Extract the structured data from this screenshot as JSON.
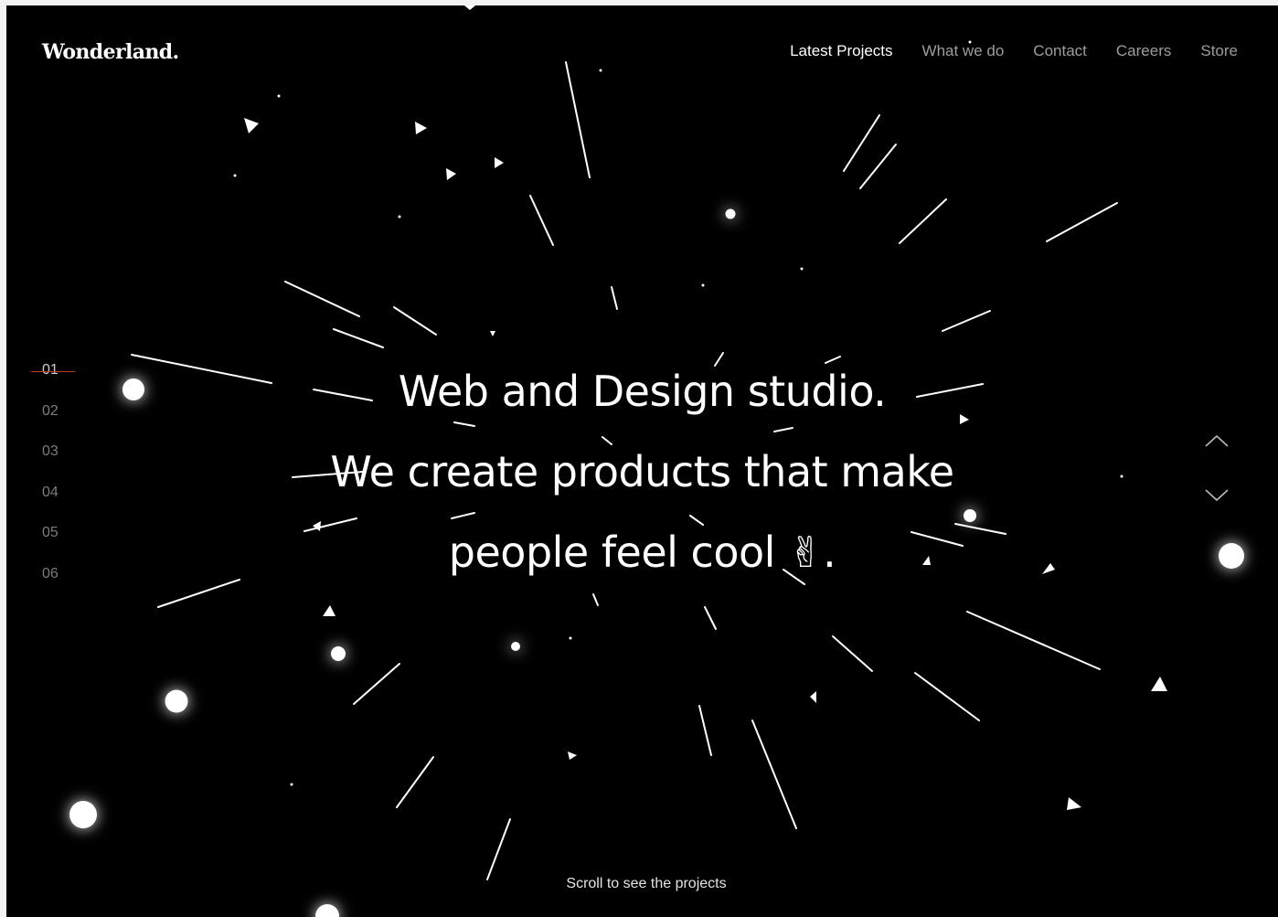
{
  "brand": {
    "name": "Wonderland."
  },
  "nav": {
    "items": [
      {
        "label": "Latest Projects",
        "active": true
      },
      {
        "label": "What we do"
      },
      {
        "label": "Contact"
      },
      {
        "label": "Careers"
      },
      {
        "label": "Store"
      }
    ]
  },
  "hero": {
    "line1": "Web and Design studio.",
    "line2": "We create products that make",
    "line3": "people feel cool ✌."
  },
  "pager": {
    "items": [
      "01",
      "02",
      "03",
      "04",
      "05",
      "06"
    ],
    "active": "01"
  },
  "controls": {
    "up_icon": "chevron-up-icon",
    "down_icon": "chevron-down-icon"
  },
  "footer": {
    "scroll_hint": "Scroll to see the projects"
  },
  "colors": {
    "background": "#000000",
    "text": "#ffffff",
    "muted": "#9d9d9d",
    "accent": "#c0392b"
  }
}
